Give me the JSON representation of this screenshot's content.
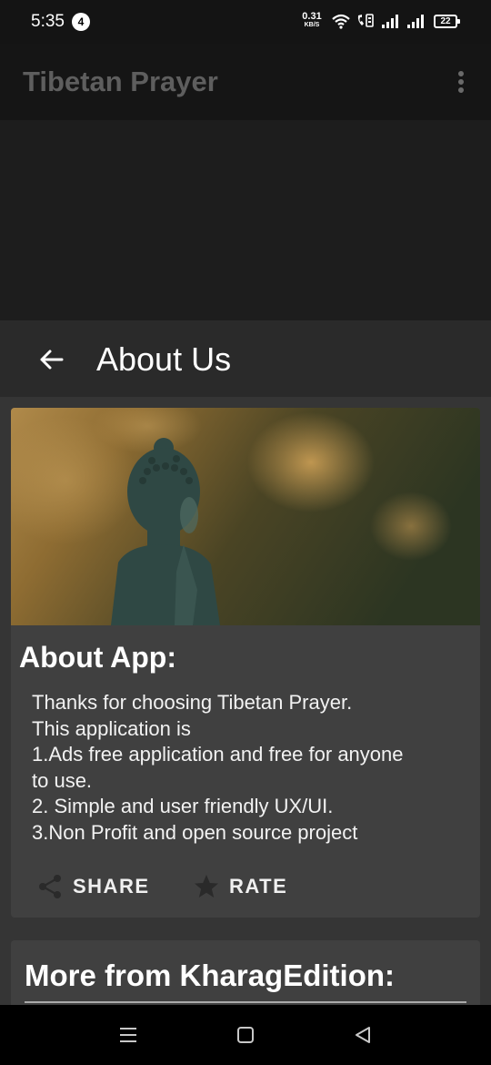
{
  "status_bar": {
    "time": "5:35",
    "notification_count": "4",
    "net_speed_value": "0.31",
    "net_speed_unit": "KB/S",
    "battery": "22",
    "icons": [
      "wifi-icon",
      "volte-icon",
      "signal-icon",
      "signal-icon",
      "battery-icon"
    ]
  },
  "app_bar": {
    "title": "Tibetan Prayer",
    "menu_icon": "more-vert-icon"
  },
  "sheet": {
    "title": "About Us",
    "back_icon": "arrow-back-icon",
    "about_card": {
      "image": "buddha-statue-photo",
      "heading": "About App:",
      "body_lines": [
        "Thanks for choosing Tibetan Prayer.",
        "This application is",
        "1.Ads free application and free for anyone",
        "to use.",
        "2. Simple and user friendly UX/UI.",
        "3.Non Profit and open source project"
      ],
      "share_label": "SHARE",
      "share_icon": "share-icon",
      "rate_label": "RATE",
      "rate_icon": "star-icon"
    },
    "more_card": {
      "heading": "More from KharagEdition:"
    }
  },
  "nav_bar": {
    "icons": [
      "menu-icon",
      "home-icon",
      "back-icon"
    ]
  },
  "colors": {
    "app_bar_bg": "#151515",
    "sheet_bg": "#353535",
    "card_bg": "#404040",
    "title_muted": "#5e5e5e"
  }
}
